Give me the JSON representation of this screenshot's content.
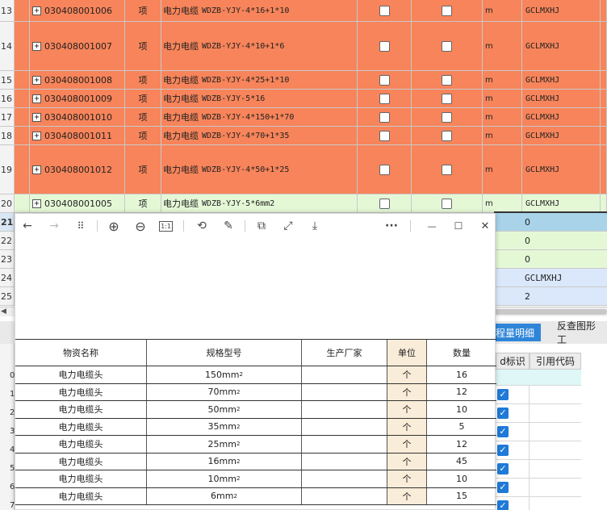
{
  "grid": {
    "rows": [
      {
        "num": "13",
        "code": "030408001006",
        "unit_type": "项",
        "name": "电力电缆",
        "spec": "WDZB-YJY-4*16+1*10",
        "unit": "m",
        "tag": "GCLMXHJ",
        "color": "orange"
      },
      {
        "num": "14",
        "code": "030408001007",
        "unit_type": "项",
        "name": "电力电缆",
        "spec": "WDZB-YJY-4*10+1*6",
        "unit": "m",
        "tag": "GCLMXHJ",
        "color": "orange"
      },
      {
        "num": "15",
        "code": "030408001008",
        "unit_type": "项",
        "name": "电力电缆",
        "spec": "WDZB-YJY-4*25+1*10",
        "unit": "m",
        "tag": "GCLMXHJ",
        "color": "orange"
      },
      {
        "num": "16",
        "code": "030408001009",
        "unit_type": "项",
        "name": "电力电缆",
        "spec": "WDZB-YJY-5*16",
        "unit": "m",
        "tag": "GCLMXHJ",
        "color": "orange"
      },
      {
        "num": "17",
        "code": "030408001010",
        "unit_type": "项",
        "name": "电力电缆",
        "spec": "WDZB-YJY-4*150+1*70",
        "unit": "m",
        "tag": "GCLMXHJ",
        "color": "orange"
      },
      {
        "num": "18",
        "code": "030408001011",
        "unit_type": "项",
        "name": "电力电缆",
        "spec": "WDZB-YJY-4*70+1*35",
        "unit": "m",
        "tag": "GCLMXHJ",
        "color": "orange"
      },
      {
        "num": "19",
        "code": "030408001012",
        "unit_type": "项",
        "name": "电力电缆",
        "spec": "WDZB-YJY-4*50+1*25",
        "unit": "m",
        "tag": "GCLMXHJ",
        "color": "orange"
      },
      {
        "num": "20",
        "code": "030408001005",
        "unit_type": "项",
        "name": "电力电缆",
        "spec": "WDZB-YJY-5*6mm2",
        "unit": "m",
        "tag": "GCLMXHJ",
        "color": "green"
      }
    ],
    "lower_rows": [
      {
        "num": "21",
        "value": "0"
      },
      {
        "num": "22",
        "value": "0"
      },
      {
        "num": "23",
        "value": "0"
      },
      {
        "num": "24",
        "value": "GCLMXHJ"
      },
      {
        "num": "25",
        "value": "2"
      }
    ],
    "plus_glyph": "+"
  },
  "tabs": {
    "active": "程量明细",
    "inactive": "反查图形工"
  },
  "right_table": {
    "col1": "d标识",
    "col2": "引用代码",
    "check_glyph": "✓"
  },
  "left_row_nums": [
    "0",
    "1",
    "2",
    "3",
    "4",
    "5",
    "6",
    "7"
  ],
  "viewer": {
    "toolbar": [
      "back-icon",
      "forward-icon",
      "grid-icon",
      "zoom-in-icon",
      "zoom-out-icon",
      "actual-size-icon",
      "rotate-icon",
      "edit-icon",
      "copy-icon",
      "fit-icon",
      "save-icon",
      "more-icon",
      "minimize-icon",
      "maximize-icon",
      "close-icon"
    ],
    "glyphs": {
      "back": "←",
      "forward": "→",
      "grid": "⠿",
      "zoom_in": "⊕",
      "zoom_out": "⊖",
      "actual": "1:1",
      "rotate": "⟲",
      "edit": "✎",
      "copy": "⧉",
      "fit": "⤢",
      "save": "⤓",
      "more": "···",
      "minimize": "—",
      "maximize": "☐",
      "close": "✕"
    },
    "table": {
      "headers": [
        "物资名称",
        "规格型号",
        "生产厂家",
        "单位",
        "数量"
      ],
      "rows": [
        {
          "name": "电力电缆头",
          "spec": "150mm",
          "sup": "2",
          "maker": "",
          "unit": "个",
          "qty": "16"
        },
        {
          "name": "电力电缆头",
          "spec": "70mm",
          "sup": "2",
          "maker": "",
          "unit": "个",
          "qty": "12"
        },
        {
          "name": "电力电缆头",
          "spec": "50mm",
          "sup": "2",
          "maker": "",
          "unit": "个",
          "qty": "10"
        },
        {
          "name": "电力电缆头",
          "spec": "35mm",
          "sup": "2",
          "maker": "",
          "unit": "个",
          "qty": "5"
        },
        {
          "name": "电力电缆头",
          "spec": "25mm",
          "sup": "2",
          "maker": "",
          "unit": "个",
          "qty": "12"
        },
        {
          "name": "电力电缆头",
          "spec": "16mm",
          "sup": "2",
          "maker": "",
          "unit": "个",
          "qty": "45"
        },
        {
          "name": "电力电缆头",
          "spec": "10mm",
          "sup": "2",
          "maker": "",
          "unit": "个",
          "qty": "10"
        },
        {
          "name": "电力电缆头",
          "spec": "6mm",
          "sup": "2",
          "maker": "",
          "unit": "个",
          "qty": "15"
        }
      ]
    }
  },
  "colors": {
    "orange_row": "#f7845a",
    "green_row": "#e4f8d6",
    "selected_tab": "#2f86d9",
    "checkbox_blue": "#1f7ad8",
    "unit_column": "#f9ecd8"
  }
}
